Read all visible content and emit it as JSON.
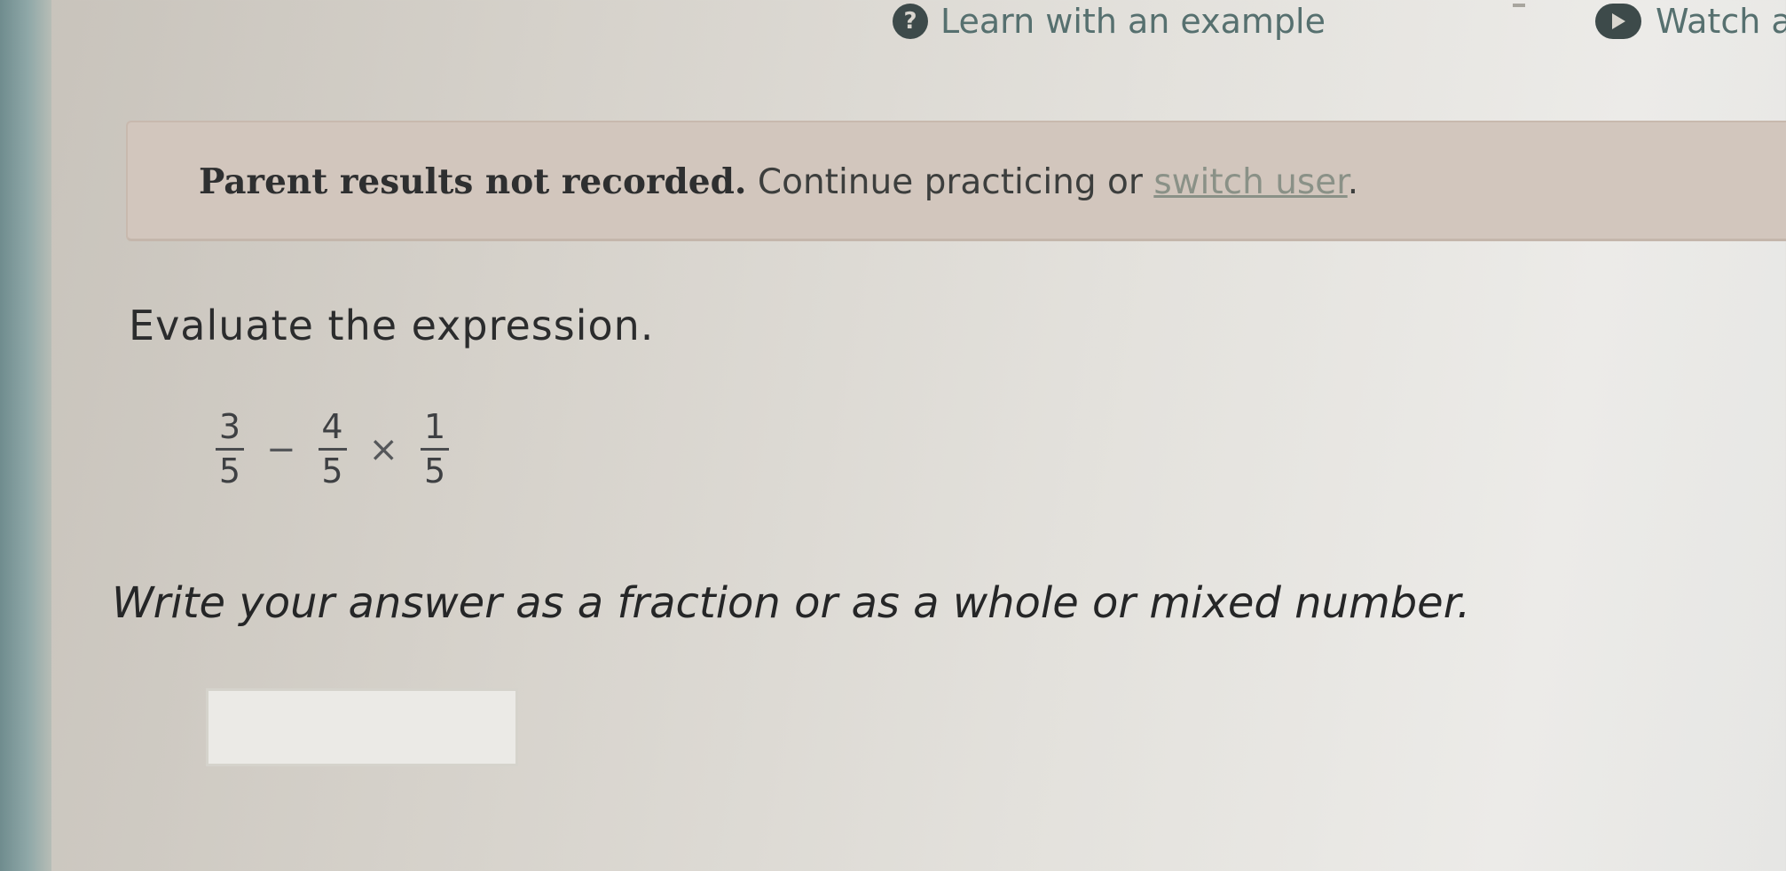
{
  "top_bar": {
    "learn_icon_glyph": "?",
    "learn_label": "Learn with an example",
    "watch_label": "Watch a"
  },
  "notice": {
    "strong_text": "Parent results not recorded.",
    "text": " Continue practicing or ",
    "link_text": "switch user",
    "end": "."
  },
  "question": {
    "prompt": "Evaluate the expression.",
    "expression": {
      "fractions": [
        {
          "numerator": "3",
          "denominator": "5"
        },
        {
          "numerator": "4",
          "denominator": "5"
        },
        {
          "numerator": "1",
          "denominator": "5"
        }
      ],
      "operators": [
        "−",
        "×"
      ]
    },
    "instruction": "Write your answer as a fraction or as a whole or mixed number.",
    "answer_value": ""
  }
}
